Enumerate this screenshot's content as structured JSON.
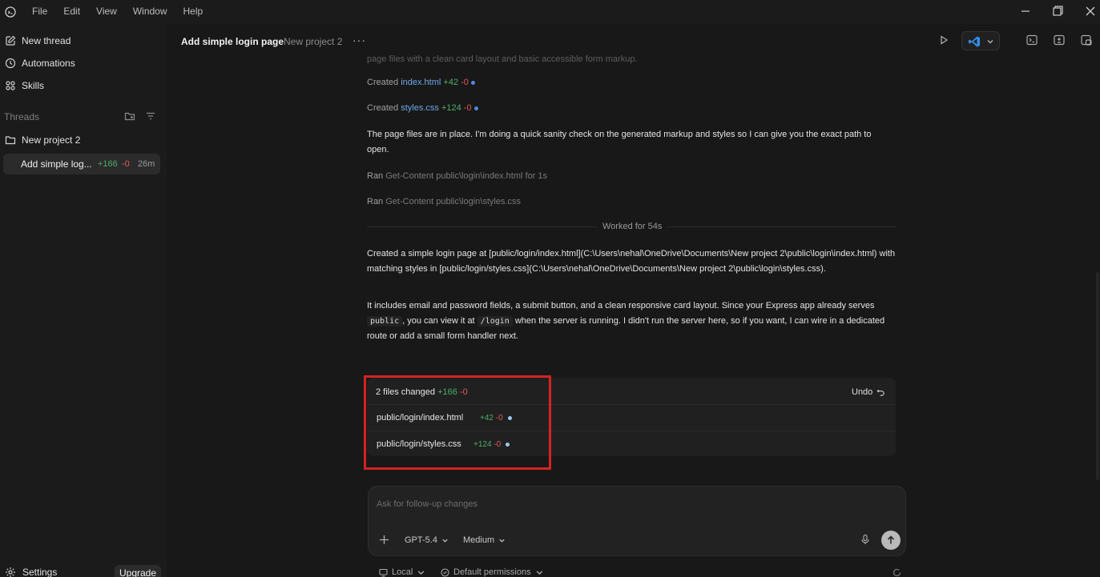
{
  "menu": [
    "File",
    "Edit",
    "View",
    "Window",
    "Help"
  ],
  "sidebar": {
    "nav": [
      {
        "label": "New thread",
        "icon": "new-thread-icon"
      },
      {
        "label": "Automations",
        "icon": "clock-icon"
      },
      {
        "label": "Skills",
        "icon": "skills-icon"
      }
    ],
    "threads_label": "Threads",
    "project": "New project 2",
    "thread": {
      "title": "Add simple log...",
      "additions": "+166",
      "deletions": "-0",
      "age": "26m"
    },
    "settings_label": "Settings",
    "upgrade_label": "Upgrade"
  },
  "header": {
    "title": "Add simple login page",
    "project": "New project 2",
    "more": "···"
  },
  "chat": {
    "created": [
      {
        "prefix": "Created",
        "file": "index.html",
        "add": "+42",
        "del": "-0"
      },
      {
        "prefix": "Created",
        "file": "styles.css",
        "add": "+124",
        "del": "-0"
      }
    ],
    "status_para": "The page files are in place. I'm doing a quick sanity check on the generated markup and styles so I can give you the exact path to open.",
    "ran": [
      {
        "prefix": "Ran",
        "cmd": "Get-Content public\\login\\index.html for 1s"
      },
      {
        "prefix": "Ran",
        "cmd": "Get-Content public\\login\\styles.css"
      }
    ],
    "worked_for": "Worked for 54s",
    "summary_para": "Created a simple login page at [public/login/index.html](C:\\Users\\nehal\\OneDrive\\Documents\\New project 2\\public\\login\\index.html) with matching styles in [public/login/styles.css](C:\\Users\\nehal\\OneDrive\\Documents\\New project 2\\public\\login\\styles.css).",
    "detail": {
      "part1": "It includes email and password fields, a submit button, and a clean responsive card layout. Since your Express app already serves ",
      "code1": "public",
      "part2": ", you can view it at ",
      "code2": "/login",
      "part3": " when the server is running. I didn't run the server here, so if you want, I can wire in a dedicated route or add a small form handler next."
    }
  },
  "changes": {
    "summary": "2 files changed",
    "add": "+166",
    "del": "-0",
    "undo_label": "Undo",
    "files": [
      {
        "name": "public/login/index.html",
        "add": "+42",
        "del": "-0"
      },
      {
        "name": "public/login/styles.css",
        "add": "+124",
        "del": "-0"
      }
    ]
  },
  "composer": {
    "placeholder": "Ask for follow-up changes",
    "model": "GPT-5.4",
    "effort": "Medium"
  },
  "footer": {
    "env": "Local",
    "permissions": "Default permissions"
  },
  "colors": {
    "accent_add": "#4caf6a",
    "accent_del": "#e05a5a",
    "link": "#6ea8e8",
    "highlight": "#d62222"
  }
}
